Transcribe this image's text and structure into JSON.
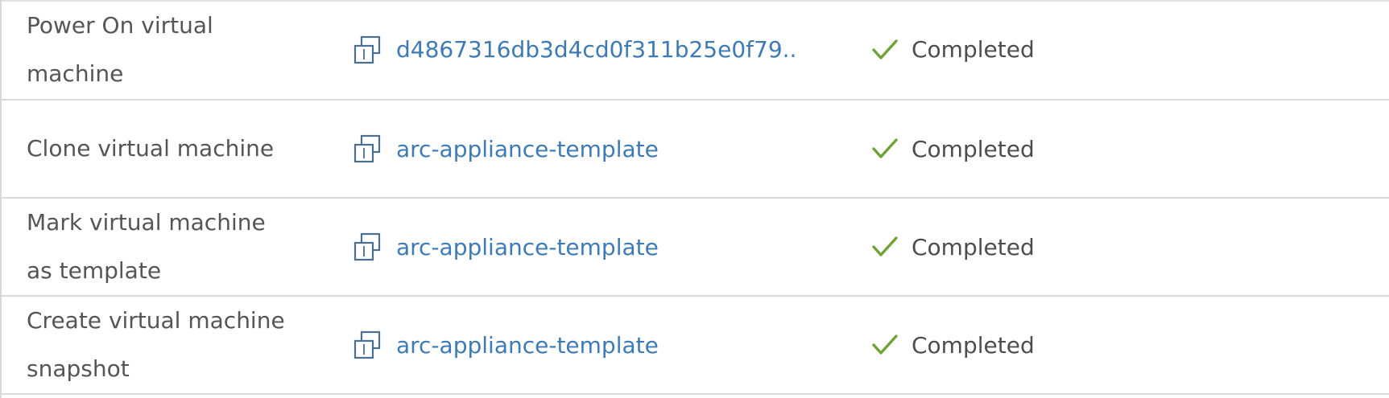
{
  "tasks": [
    {
      "name": "Power On virtual machine",
      "target": "d4867316db3d4cd0f311b25e0f79...",
      "status": "Completed"
    },
    {
      "name": "Clone virtual machine",
      "target": "arc-appliance-template",
      "status": "Completed"
    },
    {
      "name": "Mark virtual machine as template",
      "target": "arc-appliance-template",
      "status": "Completed"
    },
    {
      "name": "Create virtual machine snapshot",
      "target": "arc-appliance-template",
      "status": "Completed"
    }
  ],
  "icons": {
    "target": "vm-template-icon",
    "status": "checkmark-icon"
  },
  "colors": {
    "link": "#3e7bb6",
    "success": "#6ea437",
    "icon": "#4a6f8f",
    "divider": "#dadada"
  }
}
